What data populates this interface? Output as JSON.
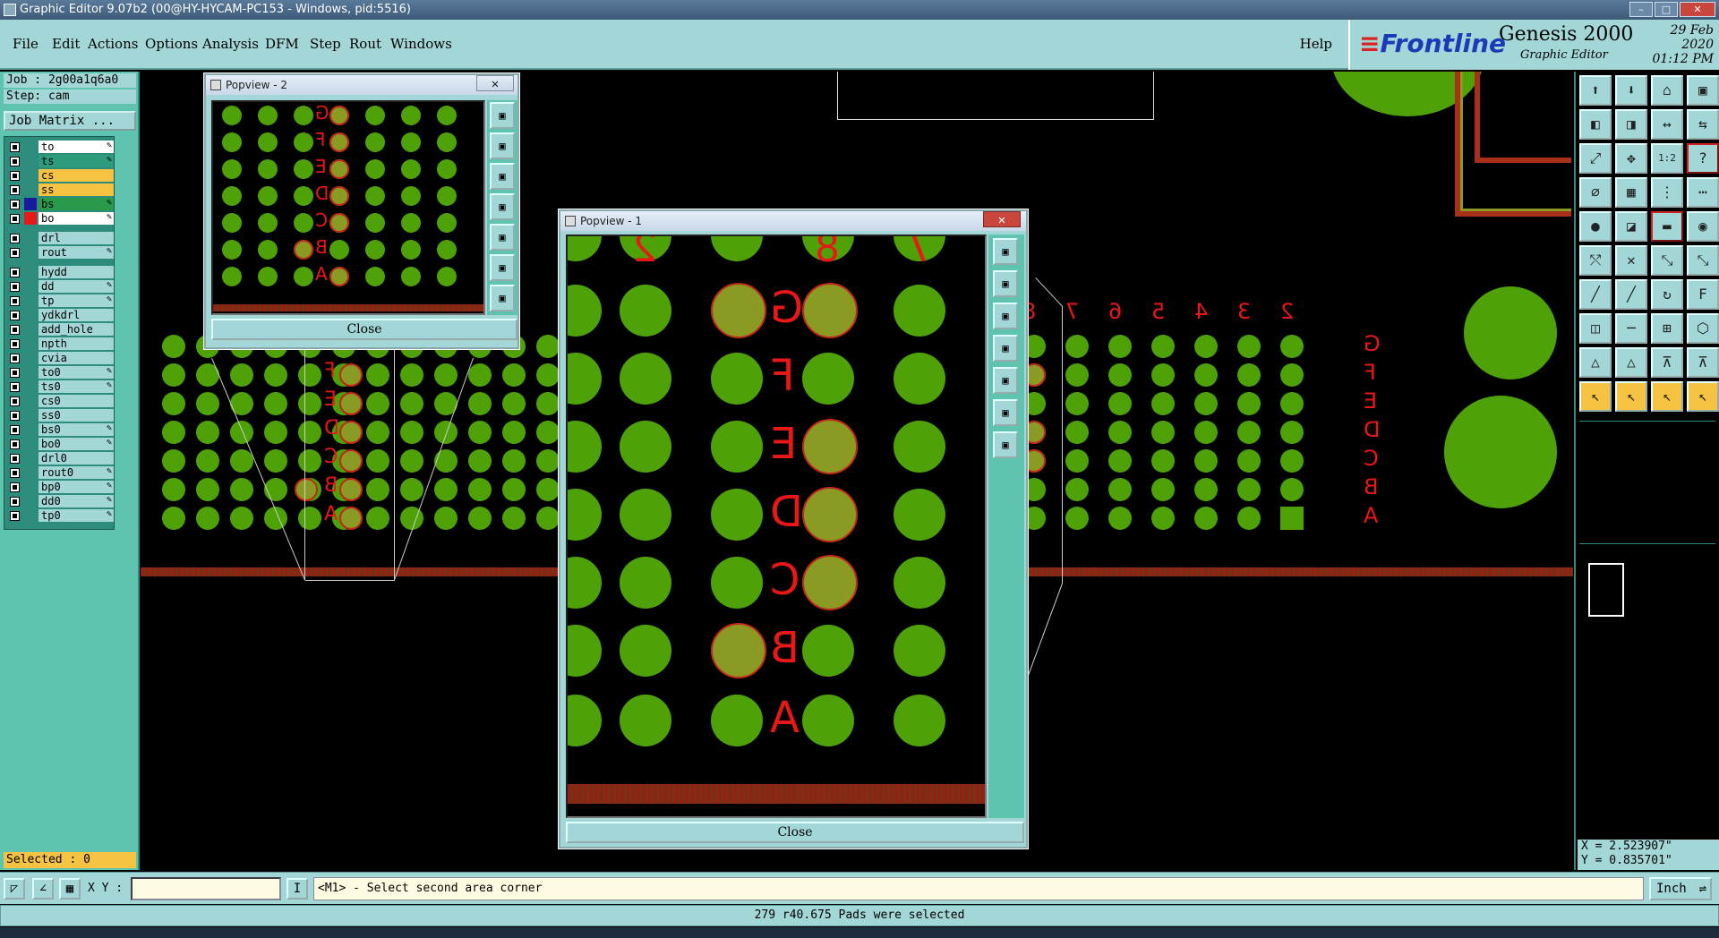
{
  "window": {
    "title": "Graphic Editor 9.07b2 (00@HY-HYCAM-PC153 - Windows, pid:5516)"
  },
  "menu": [
    "File",
    "Edit",
    "Actions",
    "Options",
    "Analysis",
    "DFM",
    "Step",
    "Rout",
    "Windows"
  ],
  "help_label": "Help",
  "brand": {
    "logo": "Frontline",
    "product": "Genesis 2000",
    "subtitle": "Graphic Editor",
    "date": "29 Feb 2020",
    "time": "01:12 PM"
  },
  "job": {
    "job_label": "Job : 2g00a1q6a0",
    "step_label": "Step: cam",
    "matrix_button": "Job Matrix ..."
  },
  "layers": [
    {
      "name": "to",
      "color": "#ffffff",
      "editable": true
    },
    {
      "name": "ts",
      "color": "#2e9c7c",
      "editable": true
    },
    {
      "name": "cs",
      "color": "#f5c242",
      "editable": false
    },
    {
      "name": "ss",
      "color": "#f5c242",
      "editable": false
    },
    {
      "name": "bs",
      "color": "#2a9a4a",
      "editable": true
    },
    {
      "name": "bo",
      "color": "#ffffff",
      "editable": true
    },
    {
      "name": "drl",
      "color": "#a3d7d7",
      "editable": false
    },
    {
      "name": "rout",
      "color": "#a3d7d7",
      "editable": true
    },
    {
      "name": "hydd",
      "color": "#a3d7d7",
      "editable": false
    },
    {
      "name": "dd",
      "color": "#a3d7d7",
      "editable": true
    },
    {
      "name": "tp",
      "color": "#a3d7d7",
      "editable": true
    },
    {
      "name": "ydkdrl",
      "color": "#a3d7d7",
      "editable": false
    },
    {
      "name": "add_hole",
      "color": "#a3d7d7",
      "editable": false
    },
    {
      "name": "npth",
      "color": "#a3d7d7",
      "editable": false
    },
    {
      "name": "cvia",
      "color": "#a3d7d7",
      "editable": false
    },
    {
      "name": "to0",
      "color": "#a3d7d7",
      "editable": true
    },
    {
      "name": "ts0",
      "color": "#a3d7d7",
      "editable": true
    },
    {
      "name": "cs0",
      "color": "#a3d7d7",
      "editable": false
    },
    {
      "name": "ss0",
      "color": "#a3d7d7",
      "editable": false
    },
    {
      "name": "bs0",
      "color": "#a3d7d7",
      "editable": true
    },
    {
      "name": "bo0",
      "color": "#a3d7d7",
      "editable": true
    },
    {
      "name": "drl0",
      "color": "#a3d7d7",
      "editable": false
    },
    {
      "name": "rout0",
      "color": "#a3d7d7",
      "editable": true
    },
    {
      "name": "bp0",
      "color": "#a3d7d7",
      "editable": true
    },
    {
      "name": "dd0",
      "color": "#a3d7d7",
      "editable": true
    },
    {
      "name": "tp0",
      "color": "#a3d7d7",
      "editable": true
    }
  ],
  "selected_label": "Selected : 0",
  "coords": {
    "x": "X = 2.523907\"",
    "y": "Y = 0.835701\""
  },
  "cmd": {
    "xy_label": "X Y :",
    "prompt": "<M1> - Select second area corner",
    "unit": "Inch"
  },
  "status": "279 r40.675 Pads were selected",
  "popview1": {
    "title": "Popview - 1",
    "close": "Close"
  },
  "popview2": {
    "title": "Popview - 2",
    "close": "Close"
  },
  "board": {
    "row_labels": [
      "G",
      "F",
      "E",
      "D",
      "C",
      "B",
      "A"
    ],
    "col_labels": [
      "8",
      "7",
      "6",
      "5",
      "4",
      "3",
      "2"
    ],
    "popview1_top_labels": [
      "2",
      "8",
      "7"
    ]
  },
  "colors": {
    "pad": "#4ea208",
    "selected_pad": "#8a9a22",
    "label": "#e81818",
    "panel": "#a3d7d7"
  }
}
